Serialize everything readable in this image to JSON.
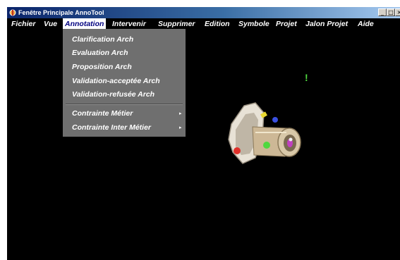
{
  "window": {
    "title": "Fenêtre Principale AnnoTool",
    "controls": {
      "minimize": "_",
      "maximize": "□",
      "close": "×"
    }
  },
  "menubar": {
    "items": [
      "Fichier",
      "Vue",
      "Annotation",
      "Intervenir",
      "Supprimer",
      "Edition",
      "Symbole",
      "Projet",
      "Jalon Projet",
      "Aide"
    ],
    "active": "Annotation"
  },
  "dropdown": {
    "items": [
      "Clarification Arch",
      "Evaluation Arch",
      "Proposition Arch",
      "Validation-acceptée Arch",
      "Validation-refusée Arch"
    ],
    "submenus": [
      "Contrainte Métier",
      "Contrainte Inter Métier"
    ],
    "submenu_arrow": "▸"
  },
  "scene": {
    "marker": "!",
    "colors": {
      "background": "#000000",
      "part_body": "#cdb896",
      "part_flange": "#e8e2d6",
      "marker_green": "#4fd83f",
      "ball_red": "#e0302a",
      "ball_blue": "#3a50e0",
      "ball_magenta": "#c040c0",
      "ball_yellow": "#e8d830"
    }
  }
}
